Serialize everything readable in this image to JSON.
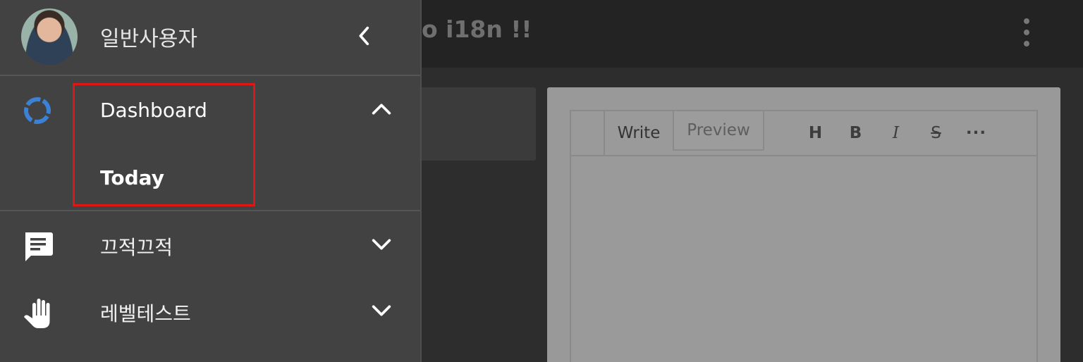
{
  "appbar": {
    "title": "o i18n !!",
    "more_icon": "more-vert-icon"
  },
  "editor": {
    "tabs": [
      {
        "label": "Write"
      },
      {
        "label": "Preview"
      }
    ],
    "format_buttons": [
      {
        "label": "H",
        "icon": "heading-icon"
      },
      {
        "label": "B",
        "icon": "bold-icon"
      },
      {
        "label": "I",
        "icon": "italic-icon"
      },
      {
        "label": "S",
        "icon": "strikethrough-icon"
      },
      {
        "label": "···",
        "icon": "more-horiz-icon"
      }
    ]
  },
  "drawer": {
    "user": {
      "name": "일반사용자",
      "avatar_icon": "avatar"
    },
    "collapse_icon": "chevron-left-icon",
    "groups": [
      {
        "label": "Dashboard",
        "icon": "loading-ring-icon",
        "expanded": true,
        "children": [
          {
            "label": "Today"
          }
        ]
      },
      {
        "label": "끄적끄적",
        "icon": "comment-icon",
        "expanded": false
      },
      {
        "label": "레벨테스트",
        "icon": "hand-icon",
        "expanded": false
      }
    ]
  },
  "colors": {
    "highlight": "#e01515",
    "accent": "#3b82d6",
    "drawer_bg": "#424242"
  }
}
